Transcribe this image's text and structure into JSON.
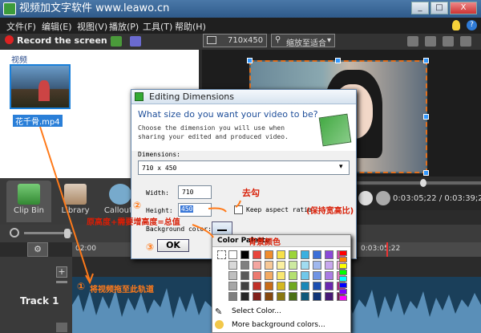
{
  "window": {
    "title": "视频加文字软件 www.leawo.cn",
    "min": "_",
    "max": "□",
    "close": "X"
  },
  "menu": [
    "文件(F)",
    "编辑(E)",
    "视图(V)",
    "播放(P)",
    "工具(T)",
    "帮助(H)"
  ],
  "toolbar": {
    "record": "Record the screen",
    "size": "710x450",
    "zoom": "缩放至适合"
  },
  "clipbin": {
    "section_label": "视频",
    "clip_name": "花千骨.mp4"
  },
  "tabs": [
    "Clip Bin",
    "Library",
    "Callouts"
  ],
  "player": {
    "timecode": "0:03:05;22 / 0:03:39;20"
  },
  "timeline": {
    "ruler_start": "02:00",
    "ruler_mid": "0:03:05;22",
    "track_label": "Track 1"
  },
  "dialog": {
    "title": "Editing Dimensions",
    "question": "What size do you want your video to be?",
    "subtitle": "Choose the dimension you will use when sharing your edited and produced video.",
    "dimensions_label": "Dimensions:",
    "dimensions_value": "710 x 450",
    "width_label": "Width:",
    "width_value": "710",
    "height_label": "Height:",
    "height_value": "450",
    "keep_aspect_label": "Keep aspect ratio",
    "bg_color_label": "Background color:",
    "ok_label": "OK"
  },
  "palette": {
    "title": "Color Palette",
    "select": "Select Color...",
    "more": "More background colors...",
    "rows": [
      [
        "#ffffff",
        "#000000",
        "#e8453c",
        "#f08c2c",
        "#f7e04a",
        "#9cd43a",
        "#3ab0e0",
        "#3a6ed8",
        "#8a4ad8",
        "#d84aa8"
      ],
      [
        "#d9d9d9",
        "#7f7f7f",
        "#f4a6a0",
        "#f8c896",
        "#fbf0a0",
        "#cdeaa0",
        "#a0dcf0",
        "#a0b8ee",
        "#c8a8ee",
        "#eeaad8"
      ],
      [
        "#bfbfbf",
        "#595959",
        "#ec7a70",
        "#f4aa62",
        "#f9e870",
        "#b4e070",
        "#70c8ea",
        "#7094e4",
        "#aa7ce4",
        "#e47ac0"
      ],
      [
        "#a6a6a6",
        "#404040",
        "#c03028",
        "#c86c18",
        "#d4b820",
        "#70a820",
        "#1a88b8",
        "#1a4eb0",
        "#6a28b0",
        "#b02880"
      ],
      [
        "#7f7f7f",
        "#262626",
        "#80201a",
        "#86480e",
        "#8a7810",
        "#4a7014",
        "#10587a",
        "#103476",
        "#461a76",
        "#761a56"
      ]
    ],
    "bright": [
      "#ff0000",
      "#ff8000",
      "#ffff00",
      "#00ff00",
      "#00ffff",
      "#0000ff",
      "#8000ff",
      "#ff00ff"
    ]
  },
  "annotations": {
    "check": "去勾",
    "keep_ratio": "(保持宽高比)",
    "formula": "原高度+需要增高度=总值",
    "bg_color": "背景颜色",
    "circle1": "①",
    "step1": "将视频拖至此轨道",
    "circle2": "②",
    "circle3": "③"
  },
  "colors": {
    "accent_orange": "#ff7a1a",
    "annotation_red": "#d81e06",
    "selection_blue": "#2a7fd8"
  }
}
